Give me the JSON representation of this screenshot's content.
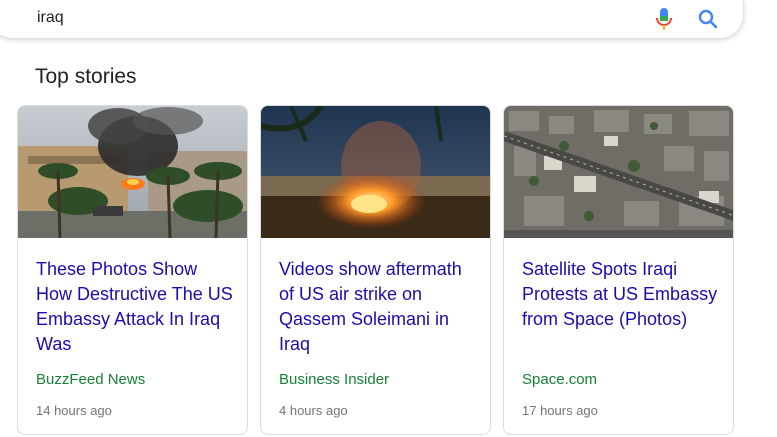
{
  "search": {
    "query": "iraq",
    "mic_icon": "microphone-icon",
    "search_icon": "search-icon"
  },
  "section": {
    "title": "Top stories"
  },
  "colors": {
    "headline": "#1a0dab",
    "source": "#188038",
    "time": "#70757a",
    "border": "#dadce0"
  },
  "stories": [
    {
      "image": "embassy-fire-photo",
      "headline": "These Photos Show How Destructive The US Embassy Attack In Iraq Was",
      "source": "BuzzFeed News",
      "time": "14 hours ago"
    },
    {
      "image": "airstrike-fire-photo",
      "headline": "Videos show aftermath of US air strike on Qassem Soleimani in Iraq",
      "source": "Business Insider",
      "time": "4 hours ago"
    },
    {
      "image": "satellite-city-photo",
      "headline": "Satellite Spots Iraqi Protests at US Embassy from Space (Photos)",
      "source": "Space.com",
      "time": "17 hours ago"
    }
  ]
}
